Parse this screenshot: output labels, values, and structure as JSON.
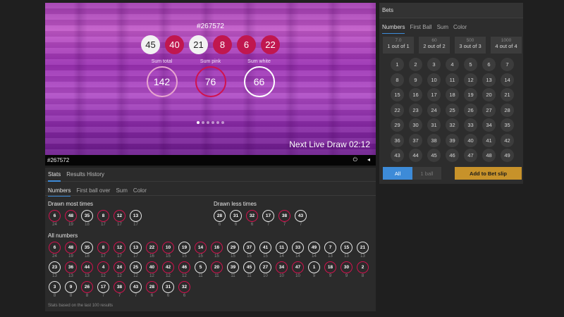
{
  "video": {
    "draw_id": "#267572",
    "balls": [
      {
        "n": "45",
        "color": "white"
      },
      {
        "n": "40",
        "color": "pink"
      },
      {
        "n": "21",
        "color": "white"
      },
      {
        "n": "8",
        "color": "pink"
      },
      {
        "n": "6",
        "color": "pink"
      },
      {
        "n": "22",
        "color": "pink"
      }
    ],
    "sums": [
      {
        "label": "Sum total",
        "value": "142",
        "kind": "total"
      },
      {
        "label": "Sum pink",
        "value": "76",
        "kind": "pink"
      },
      {
        "label": "Sum white",
        "value": "66",
        "kind": "white"
      }
    ],
    "carousel_pages": 6,
    "carousel_active": 0,
    "next_live_draw": "Next Live Draw 02:12"
  },
  "control_bar": {
    "draw_id": "#267572",
    "power_icon": "power-icon",
    "volume_icon": "volume-icon"
  },
  "stats": {
    "tabs": [
      "Stats",
      "Results History"
    ],
    "active_tab": 0,
    "sub_tabs": [
      "Numbers",
      "First ball over",
      "Sum",
      "Color"
    ],
    "active_sub_tab": 0,
    "most_title": "Drawn most times",
    "most": [
      {
        "n": "6",
        "c": "24",
        "color": "pink"
      },
      {
        "n": "48",
        "c": "19",
        "color": "pink"
      },
      {
        "n": "35",
        "c": "18",
        "color": "white"
      },
      {
        "n": "8",
        "c": "17",
        "color": "pink"
      },
      {
        "n": "12",
        "c": "17",
        "color": "pink"
      },
      {
        "n": "13",
        "c": "17",
        "color": "white"
      }
    ],
    "less_title": "Drawn less times",
    "less": [
      {
        "n": "28",
        "c": "6",
        "color": "white"
      },
      {
        "n": "31",
        "c": "6",
        "color": "white"
      },
      {
        "n": "32",
        "c": "6",
        "color": "pink"
      },
      {
        "n": "17",
        "c": "7",
        "color": "white"
      },
      {
        "n": "38",
        "c": "7",
        "color": "pink"
      },
      {
        "n": "43",
        "c": "7",
        "color": "white"
      }
    ],
    "all_title": "All numbers",
    "all_rows": [
      [
        {
          "n": "6",
          "c": "24",
          "color": "pink"
        },
        {
          "n": "48",
          "c": "19",
          "color": "pink"
        },
        {
          "n": "35",
          "c": "18",
          "color": "white"
        },
        {
          "n": "8",
          "c": "17",
          "color": "pink"
        },
        {
          "n": "12",
          "c": "17",
          "color": "pink"
        },
        {
          "n": "13",
          "c": "17",
          "color": "white"
        },
        {
          "n": "22",
          "c": "16",
          "color": "pink"
        },
        {
          "n": "10",
          "c": "15",
          "color": "pink"
        },
        {
          "n": "19",
          "c": "15",
          "color": "white"
        },
        {
          "n": "14",
          "c": "15",
          "color": "pink"
        },
        {
          "n": "16",
          "c": "15",
          "color": "pink"
        },
        {
          "n": "29",
          "c": "15",
          "color": "white"
        },
        {
          "n": "37",
          "c": "15",
          "color": "white"
        },
        {
          "n": "41",
          "c": "15",
          "color": "white"
        },
        {
          "n": "11",
          "c": "14",
          "color": "white"
        },
        {
          "n": "33",
          "c": "14",
          "color": "white"
        },
        {
          "n": "49",
          "c": "14",
          "color": "white"
        },
        {
          "n": "7",
          "c": "13",
          "color": "white"
        },
        {
          "n": "15",
          "c": "13",
          "color": "white"
        },
        {
          "n": "21",
          "c": "13",
          "color": "white"
        }
      ],
      [
        {
          "n": "23",
          "c": "13",
          "color": "white"
        },
        {
          "n": "36",
          "c": "13",
          "color": "pink"
        },
        {
          "n": "44",
          "c": "13",
          "color": "pink"
        },
        {
          "n": "4",
          "c": "12",
          "color": "pink"
        },
        {
          "n": "24",
          "c": "12",
          "color": "pink"
        },
        {
          "n": "25",
          "c": "12",
          "color": "white"
        },
        {
          "n": "40",
          "c": "12",
          "color": "pink"
        },
        {
          "n": "42",
          "c": "12",
          "color": "pink"
        },
        {
          "n": "46",
          "c": "12",
          "color": "pink"
        },
        {
          "n": "5",
          "c": "11",
          "color": "white"
        },
        {
          "n": "20",
          "c": "11",
          "color": "pink"
        },
        {
          "n": "39",
          "c": "11",
          "color": "white"
        },
        {
          "n": "45",
          "c": "11",
          "color": "white"
        },
        {
          "n": "27",
          "c": "10",
          "color": "white"
        },
        {
          "n": "34",
          "c": "10",
          "color": "pink"
        },
        {
          "n": "47",
          "c": "10",
          "color": "pink"
        },
        {
          "n": "1",
          "c": "9",
          "color": "white"
        },
        {
          "n": "18",
          "c": "9",
          "color": "pink"
        },
        {
          "n": "30",
          "c": "9",
          "color": "pink"
        },
        {
          "n": "2",
          "c": "8",
          "color": "pink"
        }
      ],
      [
        {
          "n": "3",
          "c": "8",
          "color": "white"
        },
        {
          "n": "9",
          "c": "8",
          "color": "white"
        },
        {
          "n": "26",
          "c": "8",
          "color": "pink"
        },
        {
          "n": "17",
          "c": "7",
          "color": "white"
        },
        {
          "n": "38",
          "c": "7",
          "color": "pink"
        },
        {
          "n": "43",
          "c": "7",
          "color": "white"
        },
        {
          "n": "28",
          "c": "6",
          "color": "pink"
        },
        {
          "n": "31",
          "c": "6",
          "color": "white"
        },
        {
          "n": "32",
          "c": "6",
          "color": "pink"
        }
      ]
    ],
    "footnote": "Stats based on the last 100 results"
  },
  "bets": {
    "header": "Bets",
    "tabs": [
      "Numbers",
      "First Ball",
      "Sum",
      "Color"
    ],
    "active_tab": 0,
    "odds": [
      {
        "odd": "7.0",
        "desc": "1 out of 1"
      },
      {
        "odd": "60",
        "desc": "2 out of 2"
      },
      {
        "odd": "500",
        "desc": "3 out of 3"
      },
      {
        "odd": "1000",
        "desc": "4 out of 4"
      }
    ],
    "numbers": [
      "1",
      "2",
      "3",
      "4",
      "5",
      "6",
      "7",
      "8",
      "9",
      "10",
      "11",
      "12",
      "13",
      "14",
      "15",
      "16",
      "17",
      "18",
      "19",
      "20",
      "21",
      "22",
      "23",
      "24",
      "25",
      "26",
      "27",
      "28",
      "29",
      "30",
      "31",
      "32",
      "33",
      "34",
      "35",
      "36",
      "37",
      "38",
      "39",
      "40",
      "41",
      "42",
      "43",
      "44",
      "45",
      "46",
      "47",
      "48",
      "49"
    ],
    "btn_all": "All",
    "btn_1ball": "1 ball",
    "btn_add": "Add to Bet slip"
  },
  "colors": {
    "pink": "#d0124e",
    "white": "#e6e6e6",
    "accent_blue": "#3d8bd8",
    "gold": "#c7922a"
  }
}
